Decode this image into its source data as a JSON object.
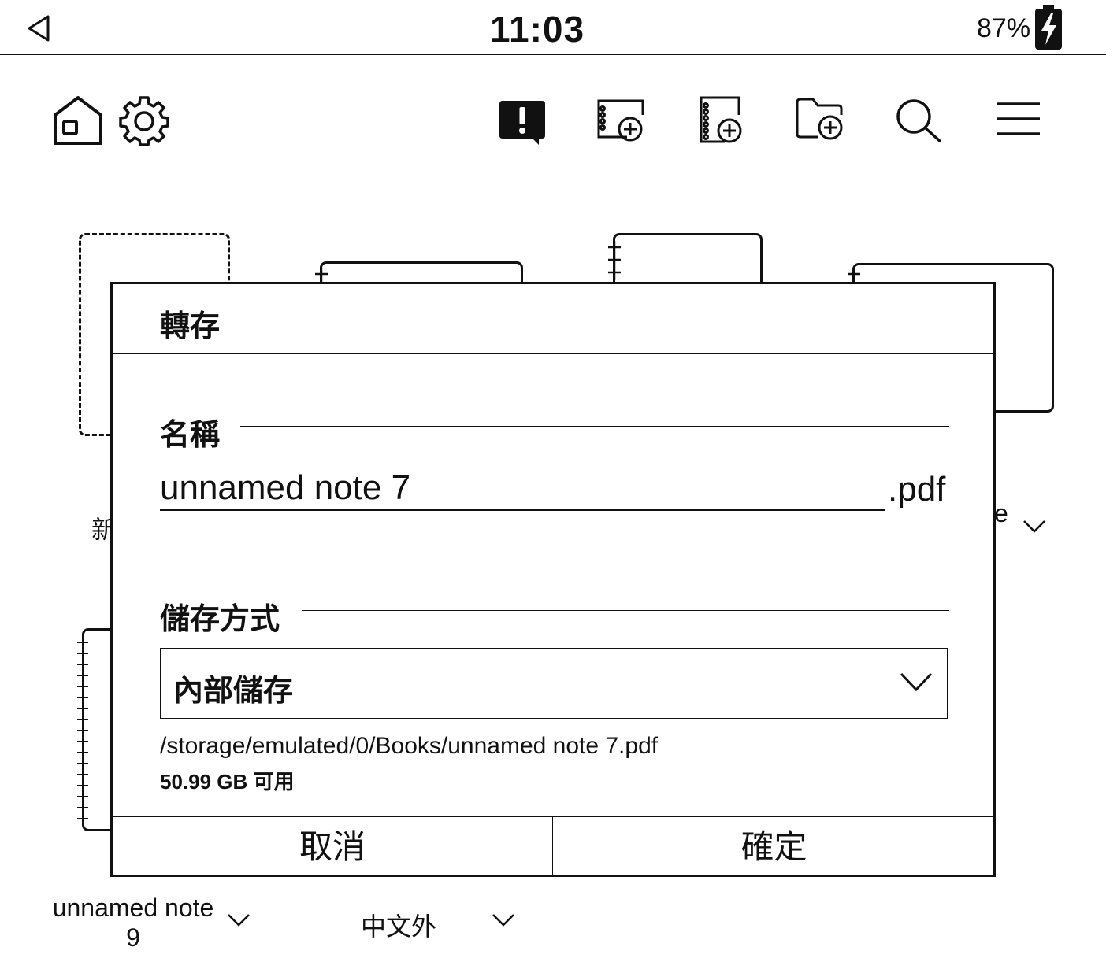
{
  "status_bar": {
    "time": "11:03",
    "battery_percent": "87%",
    "battery_charging": true
  },
  "toolbar": {
    "left_icons": [
      "home-icon",
      "gear-icon"
    ],
    "right_icons": [
      "feedback-icon",
      "new-notebook-icon",
      "new-notebook-alt-icon",
      "new-folder-icon",
      "search-icon",
      "menu-icon"
    ]
  },
  "background": {
    "tile_label_fragment_left": "新",
    "tile_label_fragment_right": "e",
    "item_1_label": "unnamed note",
    "item_1_label_line2": "9",
    "item_2_label": "中文外"
  },
  "dialog": {
    "title": "轉存",
    "name_section_label": "名稱",
    "name_value": "unnamed note 7",
    "extension": ".pdf",
    "storage_section_label": "儲存方式",
    "storage_selected": "內部儲存",
    "path": "/storage/emulated/0/Books/unnamed note 7.pdf",
    "free_space": "50.99 GB 可用",
    "cancel_label": "取消",
    "confirm_label": "確定"
  }
}
